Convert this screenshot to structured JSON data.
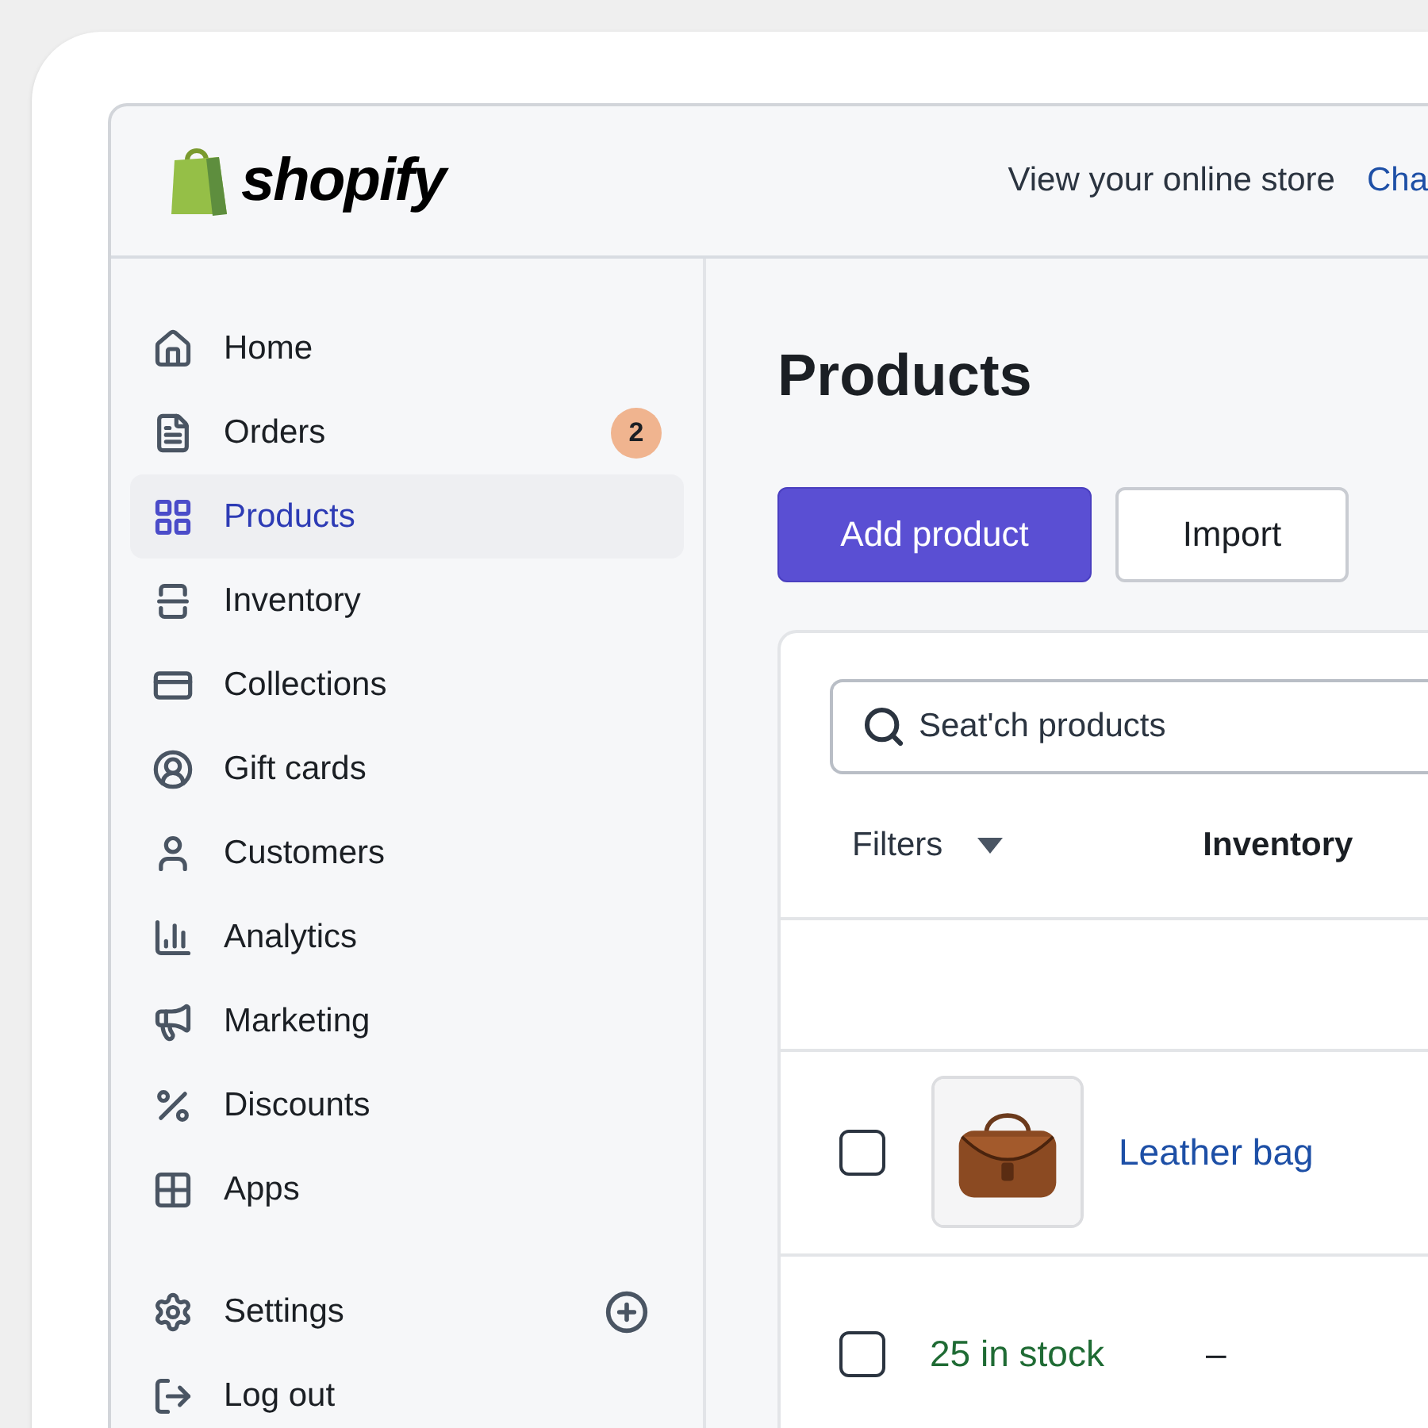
{
  "header": {
    "logo": "shopify",
    "links": [
      {
        "label": "View your online store",
        "kind": "plain"
      },
      {
        "label": "Cha",
        "kind": "link"
      }
    ]
  },
  "sidebar": {
    "items": [
      {
        "label": "Home",
        "selected": false
      },
      {
        "label": "Orders",
        "selected": false,
        "badge": "2"
      },
      {
        "label": "Products",
        "selected": true
      },
      {
        "label": "Inventory",
        "selected": false
      },
      {
        "label": "Collections",
        "selected": false
      },
      {
        "label": "Gift cards",
        "selected": false
      },
      {
        "label": "Customers",
        "selected": false
      },
      {
        "label": "Analytics",
        "selected": false
      },
      {
        "label": "Marketing",
        "selected": false
      },
      {
        "label": "Discounts",
        "selected": false
      },
      {
        "label": "Apps",
        "selected": false
      }
    ],
    "footer_items": [
      {
        "label": "Settings",
        "selected": false
      },
      {
        "label": "Log out",
        "selected": false
      }
    ]
  },
  "page": {
    "title": "Products",
    "buttons": [
      {
        "label": "Add product",
        "kind": "primary"
      },
      {
        "label": "Import",
        "kind": "secondary"
      }
    ]
  },
  "search": {
    "placeholder": "Seat'ch products"
  },
  "filters": {
    "label": "Filters",
    "column": "Inventory"
  },
  "table": {
    "rows": [
      {
        "kind": "product",
        "checked": false,
        "name": "Leather bag"
      },
      {
        "kind": "stock",
        "checked": false,
        "stock": "25 in stock",
        "column_3": "–"
      }
    ]
  }
}
